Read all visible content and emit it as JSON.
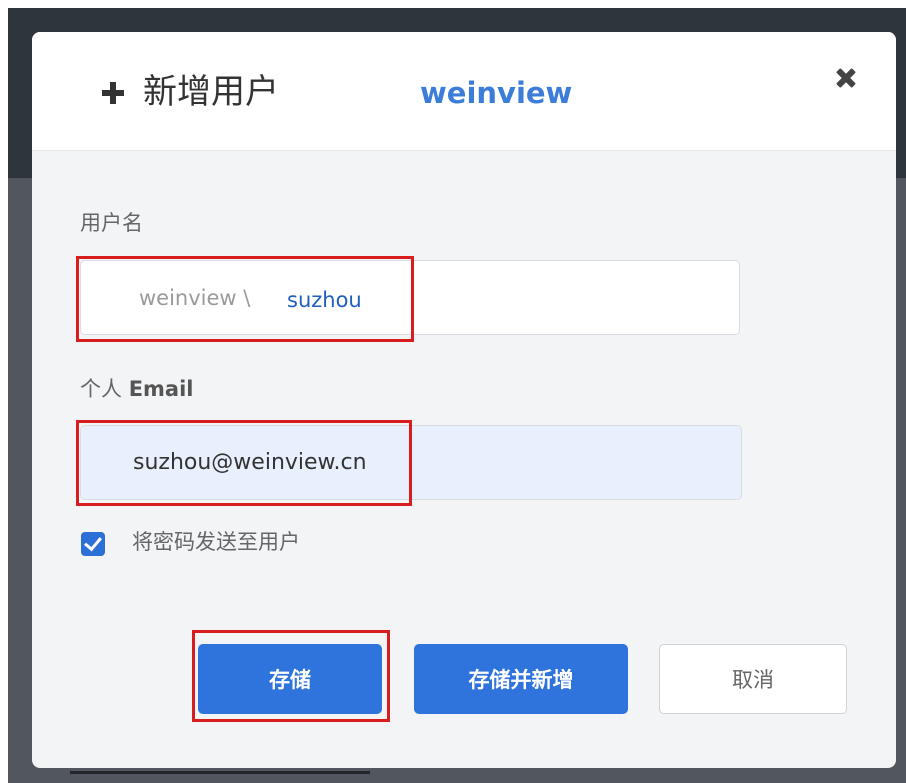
{
  "dialog": {
    "title": "新增用户",
    "subtitle": "weinview"
  },
  "form": {
    "username_label": "用户名",
    "username_prefix": "weinview \\",
    "username_value": "suzhou",
    "email_label_prefix": "个人 ",
    "email_label_bold": "Email",
    "email_value": "suzhou@weinview.cn",
    "send_password_checked": true,
    "send_password_label": "将密码发送至用户"
  },
  "buttons": {
    "save": "存储",
    "save_and_new": "存储并新增",
    "cancel": "取消"
  },
  "colors": {
    "accent": "#2f73dc",
    "highlight": "#d71d1d"
  },
  "icons": {
    "add": "plus-icon",
    "close": "close-icon",
    "check": "checkbox-checked-icon"
  }
}
